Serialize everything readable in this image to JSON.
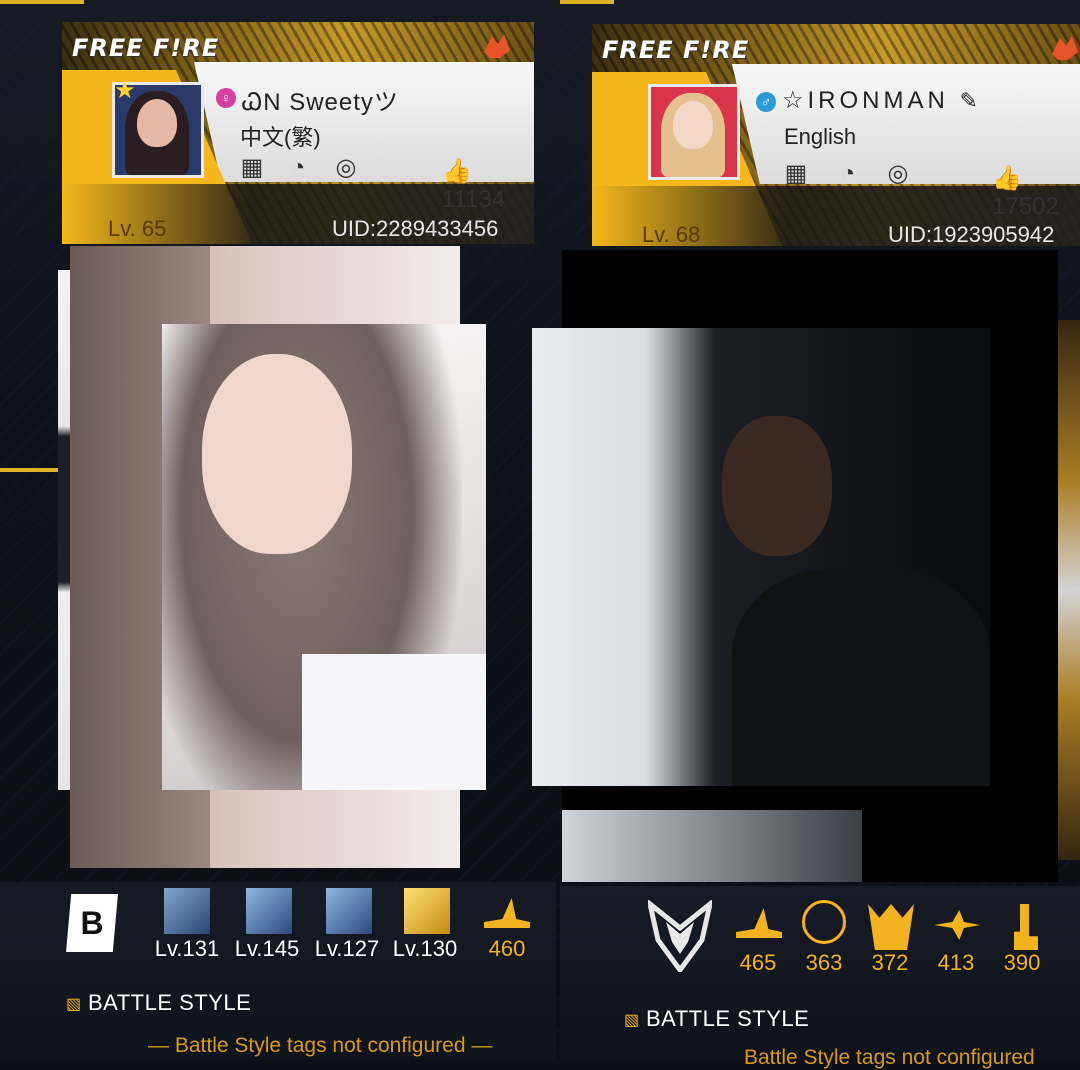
{
  "left_card": {
    "logo": "FREE F!RE",
    "name": "ᏇN Sweetyツ",
    "language": "中文(繁)",
    "likes": "11134",
    "level": "Lv. 65",
    "uid": "UID:2289433456",
    "gender_icon": "female-icon"
  },
  "right_card": {
    "logo": "FREE F!RE",
    "name": "☆IRONMAN",
    "language": "English",
    "likes": "17502",
    "level": "Lv. 68",
    "uid": "UID:1923905942",
    "gender_icon": "male-icon"
  },
  "left_badges": [
    {
      "label": "Lv.131"
    },
    {
      "label": "Lv.145"
    },
    {
      "label": "Lv.127"
    },
    {
      "label": "Lv.130"
    },
    {
      "label": "460"
    }
  ],
  "right_badges": [
    {
      "label": "465"
    },
    {
      "label": "363"
    },
    {
      "label": "372"
    },
    {
      "label": "413"
    },
    {
      "label": "390"
    }
  ],
  "left_battle_style": {
    "title": "BATTLE STYLE",
    "subtitle": "— Battle Style tags not configured —"
  },
  "right_battle_style": {
    "title": "BATTLE STYLE",
    "subtitle": "Battle Style tags not configured"
  },
  "colors": {
    "gold": "#f2b31e",
    "accent_yellow": "#f4b81c",
    "background": "#0d1018"
  }
}
